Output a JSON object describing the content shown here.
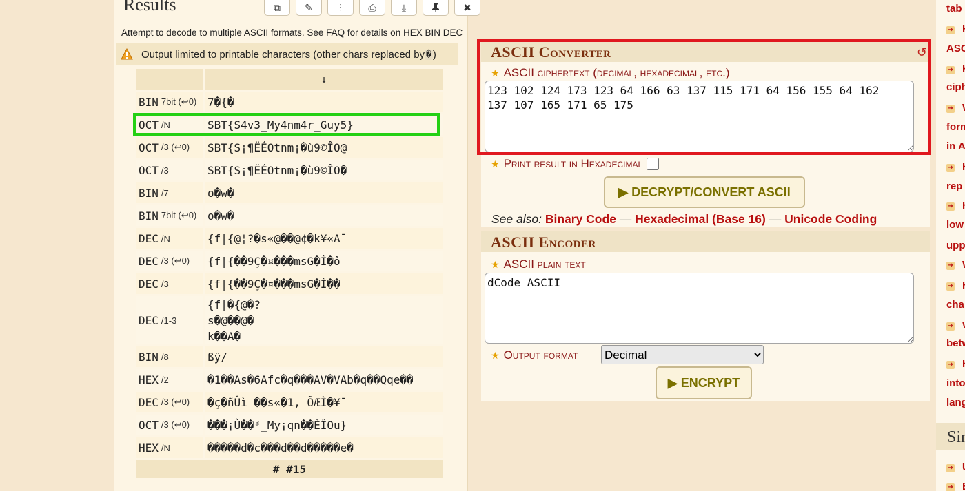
{
  "results": {
    "title": "Results",
    "toolbar_icons": [
      "copy-icon",
      "clear-icon",
      "columns-icon",
      "print-icon",
      "download-icon",
      "pin-icon",
      "close-icon"
    ],
    "toolbar_glyphs": [
      "⧉",
      "✎",
      "⫶",
      "⎙",
      "⤓",
      "📌",
      "✖"
    ],
    "decode_note": "Attempt to decode to multiple ASCII formats. See FAQ for details on HEX BIN DEC",
    "warning": "Output limited to printable characters (other chars replaced by ",
    "warning_char": "�",
    "warning_end": ")",
    "header_arrow": "↓",
    "rows": [
      {
        "fmt": "BIN",
        "sub": "7bit (↩0)",
        "val": "7�{�"
      },
      {
        "fmt": "OCT",
        "sub": "/N",
        "val": "SBT{S4v3_My4nm4r_Guy5}"
      },
      {
        "fmt": "OCT",
        "sub": "/3 (↩0)",
        "val": "SBT{S¡¶ËÉOtnm¡�ù9©ÎO@"
      },
      {
        "fmt": "OCT",
        "sub": "/3",
        "val": "SBT{S¡¶ËÉOtnm¡�ù9©ÎO�"
      },
      {
        "fmt": "BIN",
        "sub": "/7",
        "val": "o�w�"
      },
      {
        "fmt": "BIN",
        "sub": "7bit (↩0)",
        "val": "o�w�"
      },
      {
        "fmt": "DEC",
        "sub": "/N",
        "val": "{f|{@¦?�s«@��@¢�k¥«A¯"
      },
      {
        "fmt": "DEC",
        "sub": "/3 (↩0)",
        "val": "{f|{��9Ç�¤���msG�Ì�ô"
      },
      {
        "fmt": "DEC",
        "sub": "/3",
        "val": "{f|{��9Ç�¤���msG�Ì��"
      },
      {
        "fmt": "DEC",
        "sub": "/1-3",
        "val": "{f|�{@�?\ns�@��@�\nk��A�"
      },
      {
        "fmt": "BIN",
        "sub": "/8",
        "val": "ßÿ/"
      },
      {
        "fmt": "HEX",
        "sub": "/2",
        "val": "�1��As�6Afc�q���AV�VAb�q��Qqe��"
      },
      {
        "fmt": "DEC",
        "sub": "/3 (↩0)",
        "val": "�ç�ñÛì ��s«�1, ÕÆÌ�¥¯"
      },
      {
        "fmt": "OCT",
        "sub": "/3 (↩0)",
        "val": "���¡Ù��³_My¡qn��ÈÎOu}"
      },
      {
        "fmt": "HEX",
        "sub": "/N",
        "val": "�����d�c���d��d�����e�"
      }
    ],
    "footer": "# #15"
  },
  "converter": {
    "title": "ASCII Converter",
    "ciphertext_label": "ASCII ciphertext (decimal, hexadecimal, etc.)",
    "ciphertext_value": "123 102 124 173 123 64 166 63 137 115 171 64 156 155 64 162\n137 107 165 171 65 175",
    "hex_label": "Print result in Hexadecimal",
    "hex_checked": false,
    "decrypt_button": "▶ DECRYPT/CONVERT ASCII",
    "see_also_label": "See also:",
    "see_also_links": [
      "Binary Code",
      "Hexadecimal (Base 16)",
      "Unicode Coding"
    ],
    "separator": "—"
  },
  "encoder": {
    "title": "ASCII Encoder",
    "plaintext_label": "ASCII plain text",
    "plaintext_value": "dCode ASCII",
    "output_format_label": "Output format",
    "output_format_value": "Decimal",
    "encrypt_button": "▶ ENCRYPT"
  },
  "sidebar": {
    "items": [
      "tab",
      "H",
      "ASC",
      "H",
      "ciph",
      "W",
      "form",
      "in A",
      "H",
      "rep",
      "H",
      "low",
      "upp",
      "W",
      "H",
      "cha",
      "W",
      "betw",
      "H",
      "into",
      "lang"
    ],
    "section_head": "Sim",
    "bottom_items": [
      "U",
      "E"
    ]
  },
  "colors": {
    "highlight_green": "#24d014",
    "highlight_red": "#e0181f",
    "link_red": "#b80f0f"
  }
}
